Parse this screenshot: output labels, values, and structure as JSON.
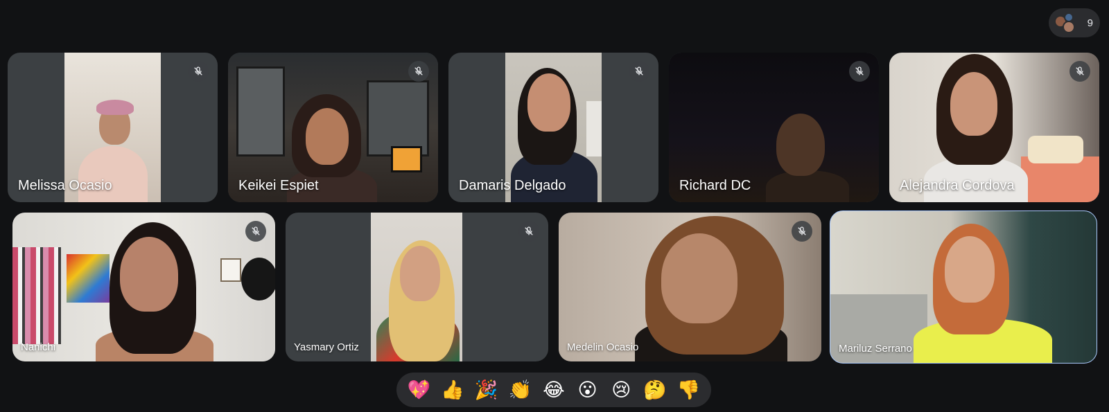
{
  "participants_pill": {
    "count": "9",
    "icon": "people-avatars-icon"
  },
  "tiles_row1": [
    {
      "name": "Melissa Ocasio",
      "muted": true
    },
    {
      "name": "Keikei Espiet",
      "muted": true
    },
    {
      "name": "Damaris Delgado",
      "muted": true
    },
    {
      "name": "Richard DC",
      "muted": true
    },
    {
      "name": "Alejandra Cordova",
      "muted": true
    }
  ],
  "tiles_row2": [
    {
      "name": "Nanichi",
      "muted": true
    },
    {
      "name": "Yasmary Ortiz",
      "muted": true
    },
    {
      "name": "Medelin Ocasio",
      "muted": true
    },
    {
      "name": "Mariluz Serrano",
      "muted": false,
      "active": true
    }
  ],
  "reactions": [
    {
      "emoji": "💖",
      "icon": "sparkling-heart-icon"
    },
    {
      "emoji": "👍",
      "icon": "thumbs-up-icon"
    },
    {
      "emoji": "🎉",
      "icon": "party-popper-icon"
    },
    {
      "emoji": "👏",
      "icon": "clapping-hands-icon"
    },
    {
      "emoji": "😂",
      "icon": "tears-of-joy-icon"
    },
    {
      "emoji": "😮",
      "icon": "surprised-face-icon"
    },
    {
      "emoji": "😢",
      "icon": "crying-face-icon"
    },
    {
      "emoji": "🤔",
      "icon": "thinking-face-icon"
    },
    {
      "emoji": "👎",
      "icon": "thumbs-down-icon"
    }
  ],
  "colors": {
    "background": "#111214",
    "tile_background": "#3c4043",
    "active_outline": "#a8c7fa",
    "pill_background": "#2b2c2f"
  }
}
